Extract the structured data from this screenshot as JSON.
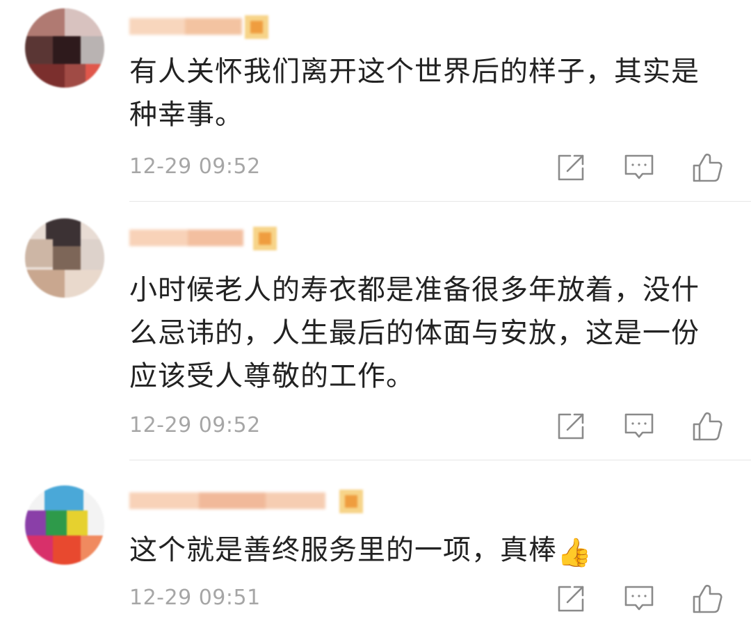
{
  "comments": [
    {
      "text": "有人关怀我们离开这个世界后的样子，其实是种幸事。",
      "emoji": "",
      "time": "12-29 09:52",
      "actions": {
        "share_icon": "share-icon",
        "reply_icon": "comment-icon",
        "like_icon": "thumbs-up-icon"
      }
    },
    {
      "text": "小时候老人的寿衣都是准备很多年放着，没什么忌讳的，人生最后的体面与安放，这是一份应该受人尊敬的工作。",
      "emoji": "",
      "time": "12-29 09:52",
      "actions": {
        "share_icon": "share-icon",
        "reply_icon": "comment-icon",
        "like_icon": "thumbs-up-icon"
      }
    },
    {
      "text": "这个就是善终服务里的一项，真棒",
      "emoji": "👍",
      "time": "12-29 09:51",
      "actions": {
        "share_icon": "share-icon",
        "reply_icon": "comment-icon",
        "like_icon": "thumbs-up-icon"
      }
    }
  ],
  "colors": {
    "text": "#222222",
    "timestamp": "#a6a6a6",
    "icon": "#8a8a8a",
    "divider": "#e6e6e6",
    "blurred_name": "#f5c7a4",
    "badge": "#f0a24a"
  }
}
